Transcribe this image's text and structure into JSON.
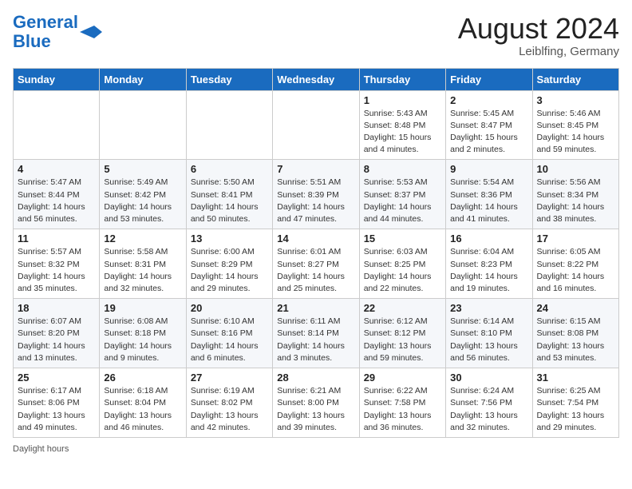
{
  "header": {
    "logo_line1": "General",
    "logo_line2": "Blue",
    "month_title": "August 2024",
    "location": "Leiblfing, Germany"
  },
  "footer": {
    "daylight_label": "Daylight hours"
  },
  "days_of_week": [
    "Sunday",
    "Monday",
    "Tuesday",
    "Wednesday",
    "Thursday",
    "Friday",
    "Saturday"
  ],
  "weeks": [
    [
      {
        "day": "",
        "info": ""
      },
      {
        "day": "",
        "info": ""
      },
      {
        "day": "",
        "info": ""
      },
      {
        "day": "",
        "info": ""
      },
      {
        "day": "1",
        "info": "Sunrise: 5:43 AM\nSunset: 8:48 PM\nDaylight: 15 hours\nand 4 minutes."
      },
      {
        "day": "2",
        "info": "Sunrise: 5:45 AM\nSunset: 8:47 PM\nDaylight: 15 hours\nand 2 minutes."
      },
      {
        "day": "3",
        "info": "Sunrise: 5:46 AM\nSunset: 8:45 PM\nDaylight: 14 hours\nand 59 minutes."
      }
    ],
    [
      {
        "day": "4",
        "info": "Sunrise: 5:47 AM\nSunset: 8:44 PM\nDaylight: 14 hours\nand 56 minutes."
      },
      {
        "day": "5",
        "info": "Sunrise: 5:49 AM\nSunset: 8:42 PM\nDaylight: 14 hours\nand 53 minutes."
      },
      {
        "day": "6",
        "info": "Sunrise: 5:50 AM\nSunset: 8:41 PM\nDaylight: 14 hours\nand 50 minutes."
      },
      {
        "day": "7",
        "info": "Sunrise: 5:51 AM\nSunset: 8:39 PM\nDaylight: 14 hours\nand 47 minutes."
      },
      {
        "day": "8",
        "info": "Sunrise: 5:53 AM\nSunset: 8:37 PM\nDaylight: 14 hours\nand 44 minutes."
      },
      {
        "day": "9",
        "info": "Sunrise: 5:54 AM\nSunset: 8:36 PM\nDaylight: 14 hours\nand 41 minutes."
      },
      {
        "day": "10",
        "info": "Sunrise: 5:56 AM\nSunset: 8:34 PM\nDaylight: 14 hours\nand 38 minutes."
      }
    ],
    [
      {
        "day": "11",
        "info": "Sunrise: 5:57 AM\nSunset: 8:32 PM\nDaylight: 14 hours\nand 35 minutes."
      },
      {
        "day": "12",
        "info": "Sunrise: 5:58 AM\nSunset: 8:31 PM\nDaylight: 14 hours\nand 32 minutes."
      },
      {
        "day": "13",
        "info": "Sunrise: 6:00 AM\nSunset: 8:29 PM\nDaylight: 14 hours\nand 29 minutes."
      },
      {
        "day": "14",
        "info": "Sunrise: 6:01 AM\nSunset: 8:27 PM\nDaylight: 14 hours\nand 25 minutes."
      },
      {
        "day": "15",
        "info": "Sunrise: 6:03 AM\nSunset: 8:25 PM\nDaylight: 14 hours\nand 22 minutes."
      },
      {
        "day": "16",
        "info": "Sunrise: 6:04 AM\nSunset: 8:23 PM\nDaylight: 14 hours\nand 19 minutes."
      },
      {
        "day": "17",
        "info": "Sunrise: 6:05 AM\nSunset: 8:22 PM\nDaylight: 14 hours\nand 16 minutes."
      }
    ],
    [
      {
        "day": "18",
        "info": "Sunrise: 6:07 AM\nSunset: 8:20 PM\nDaylight: 14 hours\nand 13 minutes."
      },
      {
        "day": "19",
        "info": "Sunrise: 6:08 AM\nSunset: 8:18 PM\nDaylight: 14 hours\nand 9 minutes."
      },
      {
        "day": "20",
        "info": "Sunrise: 6:10 AM\nSunset: 8:16 PM\nDaylight: 14 hours\nand 6 minutes."
      },
      {
        "day": "21",
        "info": "Sunrise: 6:11 AM\nSunset: 8:14 PM\nDaylight: 14 hours\nand 3 minutes."
      },
      {
        "day": "22",
        "info": "Sunrise: 6:12 AM\nSunset: 8:12 PM\nDaylight: 13 hours\nand 59 minutes."
      },
      {
        "day": "23",
        "info": "Sunrise: 6:14 AM\nSunset: 8:10 PM\nDaylight: 13 hours\nand 56 minutes."
      },
      {
        "day": "24",
        "info": "Sunrise: 6:15 AM\nSunset: 8:08 PM\nDaylight: 13 hours\nand 53 minutes."
      }
    ],
    [
      {
        "day": "25",
        "info": "Sunrise: 6:17 AM\nSunset: 8:06 PM\nDaylight: 13 hours\nand 49 minutes."
      },
      {
        "day": "26",
        "info": "Sunrise: 6:18 AM\nSunset: 8:04 PM\nDaylight: 13 hours\nand 46 minutes."
      },
      {
        "day": "27",
        "info": "Sunrise: 6:19 AM\nSunset: 8:02 PM\nDaylight: 13 hours\nand 42 minutes."
      },
      {
        "day": "28",
        "info": "Sunrise: 6:21 AM\nSunset: 8:00 PM\nDaylight: 13 hours\nand 39 minutes."
      },
      {
        "day": "29",
        "info": "Sunrise: 6:22 AM\nSunset: 7:58 PM\nDaylight: 13 hours\nand 36 minutes."
      },
      {
        "day": "30",
        "info": "Sunrise: 6:24 AM\nSunset: 7:56 PM\nDaylight: 13 hours\nand 32 minutes."
      },
      {
        "day": "31",
        "info": "Sunrise: 6:25 AM\nSunset: 7:54 PM\nDaylight: 13 hours\nand 29 minutes."
      }
    ]
  ]
}
